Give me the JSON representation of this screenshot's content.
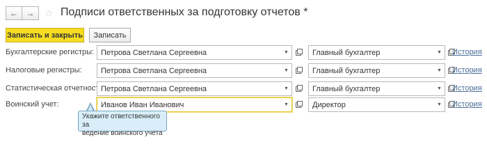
{
  "toolbar": {
    "back_icon": "←",
    "forward_icon": "→",
    "favorite_icon": "☆",
    "title": "Подписи ответственных за подготовку отчетов *"
  },
  "actions": {
    "save_close_label": "Записать и закрыть",
    "save_label": "Записать"
  },
  "rows": [
    {
      "label": "Бухгалтерские регистры:",
      "person": "Петрова Светлана Сергеевна",
      "position": "Главный бухгалтер",
      "history": "История"
    },
    {
      "label": "Налоговые регистры:",
      "person": "Петрова Светлана Сергеевна",
      "position": "Главный бухгалтер",
      "history": "История"
    },
    {
      "label": "Статистическая отчетность:",
      "person": "Петрова Светлана Сергеевна",
      "position": "Главный бухгалтер",
      "history": "История"
    },
    {
      "label": "Воинский учет:",
      "person": "Иванов Иван Иванович",
      "position": "Директор",
      "history": "История"
    }
  ],
  "tooltip": {
    "line1": "Укажите ответственного за",
    "line2": "ведение воинского учета"
  },
  "colors": {
    "primary_button": "#f6dc23",
    "link": "#4b6e9a",
    "tooltip_bg": "#d9eef9",
    "focus_border": "#e6c52a"
  }
}
